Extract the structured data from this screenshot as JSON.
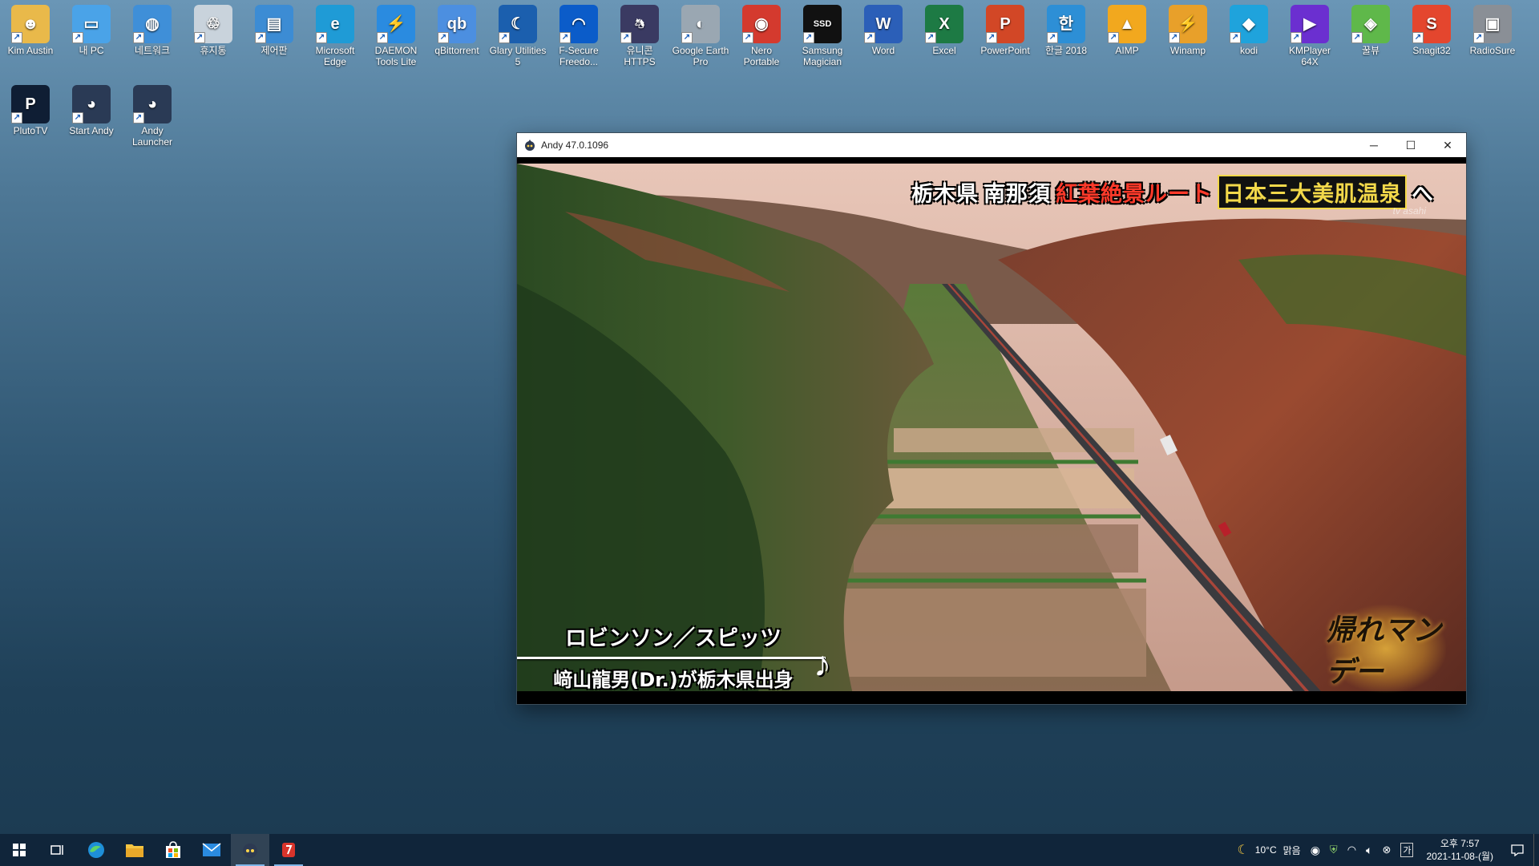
{
  "desktop": {
    "icons": [
      {
        "label": "Kim Austin",
        "icon": "user-folder-icon",
        "color": "#e9b94a"
      },
      {
        "label": "내 PC",
        "icon": "computer-icon",
        "color": "#4aa3e8"
      },
      {
        "label": "네트워크",
        "icon": "network-icon",
        "color": "#3f8fd8"
      },
      {
        "label": "휴지통",
        "icon": "recycle-bin-icon",
        "color": "#c9d3dc"
      },
      {
        "label": "제어판",
        "icon": "control-panel-icon",
        "color": "#3c8cd4"
      },
      {
        "label": "Microsoft Edge",
        "icon": "edge-icon",
        "color": "#1f9bd6"
      },
      {
        "label": "DAEMON Tools Lite",
        "icon": "daemon-tools-icon",
        "color": "#2a8be0"
      },
      {
        "label": "qBittorrent",
        "icon": "qbittorrent-icon",
        "color": "#4c8fe0"
      },
      {
        "label": "Glary Utilities 5",
        "icon": "glary-utilities-icon",
        "color": "#1b5fae"
      },
      {
        "label": "F-Secure Freedo...",
        "icon": "f-secure-icon",
        "color": "#0b5cc9"
      },
      {
        "label": "유니콘 HTTPS",
        "icon": "unicorn-https-icon",
        "color": "#3a3a62"
      },
      {
        "label": "Google Earth Pro",
        "icon": "google-earth-icon",
        "color": "#9aa7b2"
      },
      {
        "label": "Nero Portable",
        "icon": "nero-icon",
        "color": "#d43a2e"
      },
      {
        "label": "Samsung Magician",
        "icon": "samsung-magician-icon",
        "color": "#111111"
      },
      {
        "label": "Word",
        "icon": "word-icon",
        "color": "#2b5fb8"
      },
      {
        "label": "Excel",
        "icon": "excel-icon",
        "color": "#1d7a44"
      },
      {
        "label": "PowerPoint",
        "icon": "powerpoint-icon",
        "color": "#d24726"
      },
      {
        "label": "한글 2018",
        "icon": "hangul-icon",
        "color": "#2d8fd6"
      },
      {
        "label": "AIMP",
        "icon": "aimp-icon",
        "color": "#f2a81e"
      },
      {
        "label": "Winamp",
        "icon": "winamp-icon",
        "color": "#e8a02a"
      },
      {
        "label": "kodi",
        "icon": "kodi-icon",
        "color": "#1fa3dc"
      },
      {
        "label": "KMPlayer 64X",
        "icon": "kmplayer-icon",
        "color": "#6b2fd0"
      },
      {
        "label": "꿀뷰",
        "icon": "honeyview-icon",
        "color": "#5fb84a"
      },
      {
        "label": "Snagit32",
        "icon": "snagit-icon",
        "color": "#e4462e"
      },
      {
        "label": "RadioSure",
        "icon": "radiosure-icon",
        "color": "#8a8f96"
      }
    ],
    "icons_row2": [
      {
        "label": "PlutoTV",
        "icon": "plutotv-icon",
        "color": "#0f1e34"
      },
      {
        "label": "Start Andy",
        "icon": "andy-icon",
        "color": "#2a3a55"
      },
      {
        "label": "Andy Launcher",
        "icon": "andy-launcher-icon",
        "color": "#2a3a55"
      }
    ]
  },
  "window": {
    "title": "Andy 47.0.1096",
    "minimize_glyph": "─",
    "maximize_glyph": "☐",
    "close_glyph": "✕"
  },
  "video": {
    "top_caption": {
      "seg1": "栃木県",
      "seg2": "南那須",
      "seg3": "紅葉絶景ルート",
      "seg4": "日本三大美肌温泉",
      "arrow": "へ"
    },
    "channel_mark": "tv asahi",
    "song_caption": {
      "line1": "ロビンソン／スピッツ",
      "line2": "﨑山龍男(Dr.)が栃木県出身",
      "note": "♪"
    },
    "show_logo": "帰れマンデー"
  },
  "taskbar": {
    "weather": {
      "temp": "10°C",
      "condition": "맑음",
      "icon": "moon-icon"
    },
    "clock": {
      "time": "오후 7:57",
      "date": "2021-11-08-(월)"
    },
    "ime": "가"
  }
}
